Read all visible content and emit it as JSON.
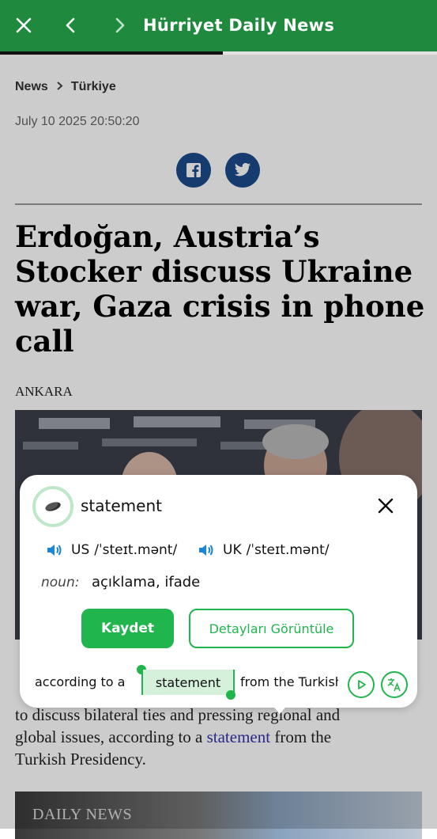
{
  "header": {
    "title": "Hürriyet Daily News",
    "icons": {
      "close": "close-icon",
      "back": "chevron-left-icon",
      "forward": "chevron-right-icon"
    },
    "color": "#1f8a3d"
  },
  "reading_progress": 0.51,
  "article": {
    "breadcrumb": {
      "root": "News",
      "section": "Türkiye"
    },
    "date": "July 10 2025 20:50:20",
    "share_icons": [
      "facebook-icon",
      "twitter-icon"
    ],
    "headline": "Erdoğan, Austria’s Stocker discuss Ukraine war, Gaza crisis in phone call",
    "dateline": "ANKARA",
    "body": {
      "line1_start": "to discuss bilateral ties and pressing regional and",
      "line2_start": "global issues, according to a ",
      "line2_link": "statement",
      "line2_end": " from the",
      "line3": "Turkish Presidency."
    },
    "second_image_logo": "DAILY NEWS"
  },
  "popup": {
    "word": "statement",
    "us_label": "US",
    "us_ipa": "/ˈsteɪt.mənt/",
    "uk_label": "UK",
    "uk_ipa": "/ˈsteɪt.mənt/",
    "part_of_speech": "noun:",
    "meaning": "açıklama, ifade",
    "save_button": "Kaydet",
    "details_button": "Detayları Görüntüle",
    "context_before": "according to a",
    "context_highlight": "statement",
    "context_after": "from the Turkish",
    "accent": "#21b54d"
  }
}
